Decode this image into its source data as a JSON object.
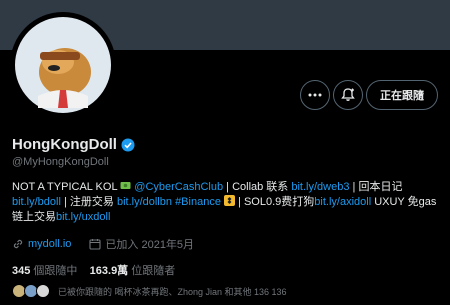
{
  "profile": {
    "name": "HongKongDoll",
    "handle": "@MyHongKongDoll",
    "follow_label": "正在跟隨"
  },
  "bio": {
    "t1": "NOT A TYPICAL KOL",
    "l1": "@CyberCashClub",
    "t2": " | Collab 联系 ",
    "l2": "bit.ly/dweb3",
    "t3": " | 回本日记",
    "l3": "bit.ly/bdoll",
    "t4": " | 注册交易 ",
    "l4": "bit.ly/dollbn",
    "l5": "#Binance",
    "t5": " | SOL0.9费打狗",
    "l6": "bit.ly/axidoll",
    "t6": " UXUY 免gas链上交易",
    "l7": "bit.ly/uxdoll"
  },
  "meta": {
    "website": "mydoll.io",
    "joined": "已加入 2021年5月"
  },
  "counts": {
    "following_num": "345",
    "following_label": " 個跟隨中",
    "followers_num": "163.9萬",
    "followers_label": " 位跟隨者"
  },
  "followed_by": "已被你跟隨的 喝杯冰茶再跑、Zhong Jian 和其他 136 136",
  "icons": [
    "more-icon",
    "notification-add-icon",
    "verified-icon",
    "link-icon",
    "calendar-icon"
  ]
}
